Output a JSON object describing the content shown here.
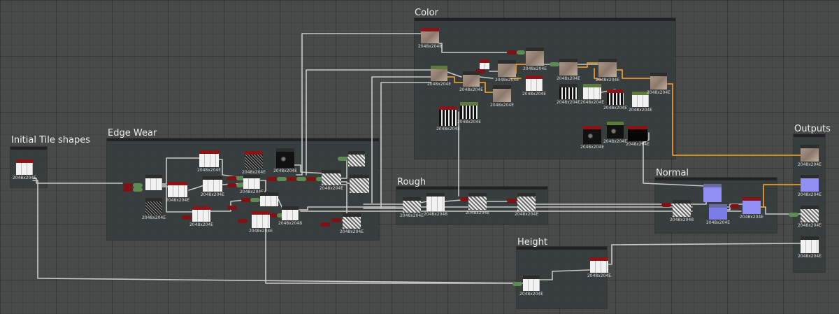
{
  "frames": [
    {
      "id": "tile",
      "title": "Initial Tile shapes"
    },
    {
      "id": "edge",
      "title": "Edge Wear"
    },
    {
      "id": "color",
      "title": "Color"
    },
    {
      "id": "rough",
      "title": "Rough"
    },
    {
      "id": "normal",
      "title": "Normal"
    },
    {
      "id": "height",
      "title": "Height"
    },
    {
      "id": "outputs",
      "title": "Outputs"
    }
  ],
  "node_label": "2048x2048",
  "node_label_short": "2048x204E",
  "colors": {
    "background": "#474a49",
    "frame": "#373c3c",
    "wire_gray": "#c8c8c8",
    "wire_orange": "#e59a2c",
    "node_header_red": "#8a1418",
    "node_header_green": "#5f7a3f",
    "normal_blue": "#8f8ff4"
  },
  "icons": {
    "graph_node": "graph-node-icon",
    "connector": "connector-icon"
  }
}
